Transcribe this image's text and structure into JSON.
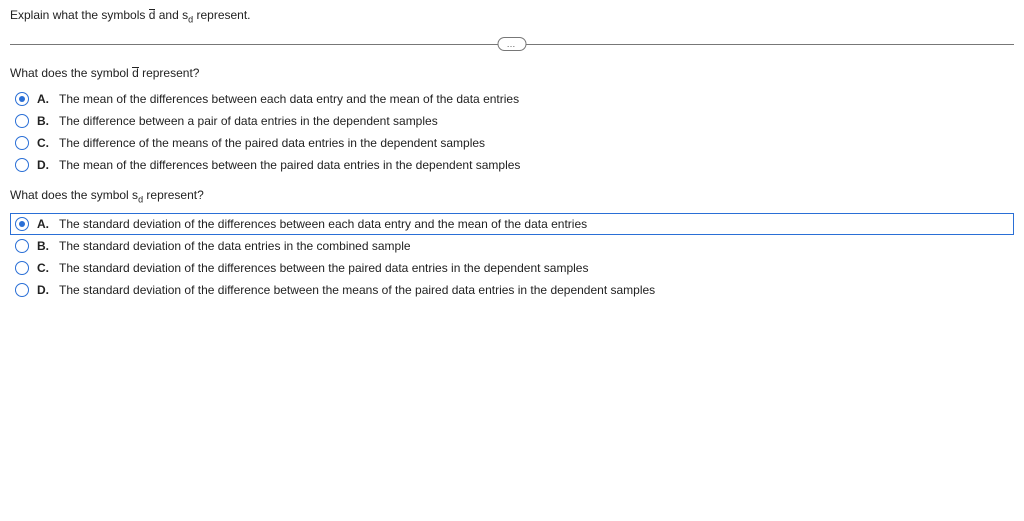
{
  "prompt_parts": [
    "Explain what the symbols ",
    " and s",
    " represent."
  ],
  "prompt_dbar": "d",
  "prompt_sub": "d",
  "pill": "…",
  "q1": {
    "text_before": "What does the symbol ",
    "dbar": "d",
    "text_after": " represent?",
    "options": [
      {
        "letter": "A.",
        "text": "The mean of the differences between each data entry and the mean of the data entries",
        "selected": true,
        "highlight": false
      },
      {
        "letter": "B.",
        "text": "The difference between a pair of data entries in the dependent samples",
        "selected": false,
        "highlight": false
      },
      {
        "letter": "C.",
        "text": "The difference of the means of the paired data entries in the dependent samples",
        "selected": false,
        "highlight": false
      },
      {
        "letter": "D.",
        "text": "The mean of the differences between the paired data entries in the dependent samples",
        "selected": false,
        "highlight": false
      }
    ]
  },
  "q2": {
    "text_before": "What does the symbol s",
    "sub": "d",
    "text_after": " represent?",
    "options": [
      {
        "letter": "A.",
        "text": "The standard deviation of the differences between each data entry and the mean of the data entries",
        "selected": true,
        "highlight": true
      },
      {
        "letter": "B.",
        "text": "The standard deviation of the data entries in the combined sample",
        "selected": false,
        "highlight": false
      },
      {
        "letter": "C.",
        "text": "The standard deviation of the differences between the paired data entries in the dependent samples",
        "selected": false,
        "highlight": false
      },
      {
        "letter": "D.",
        "text": "The standard deviation of the difference between the means of the paired data entries in the dependent samples",
        "selected": false,
        "highlight": false
      }
    ]
  }
}
